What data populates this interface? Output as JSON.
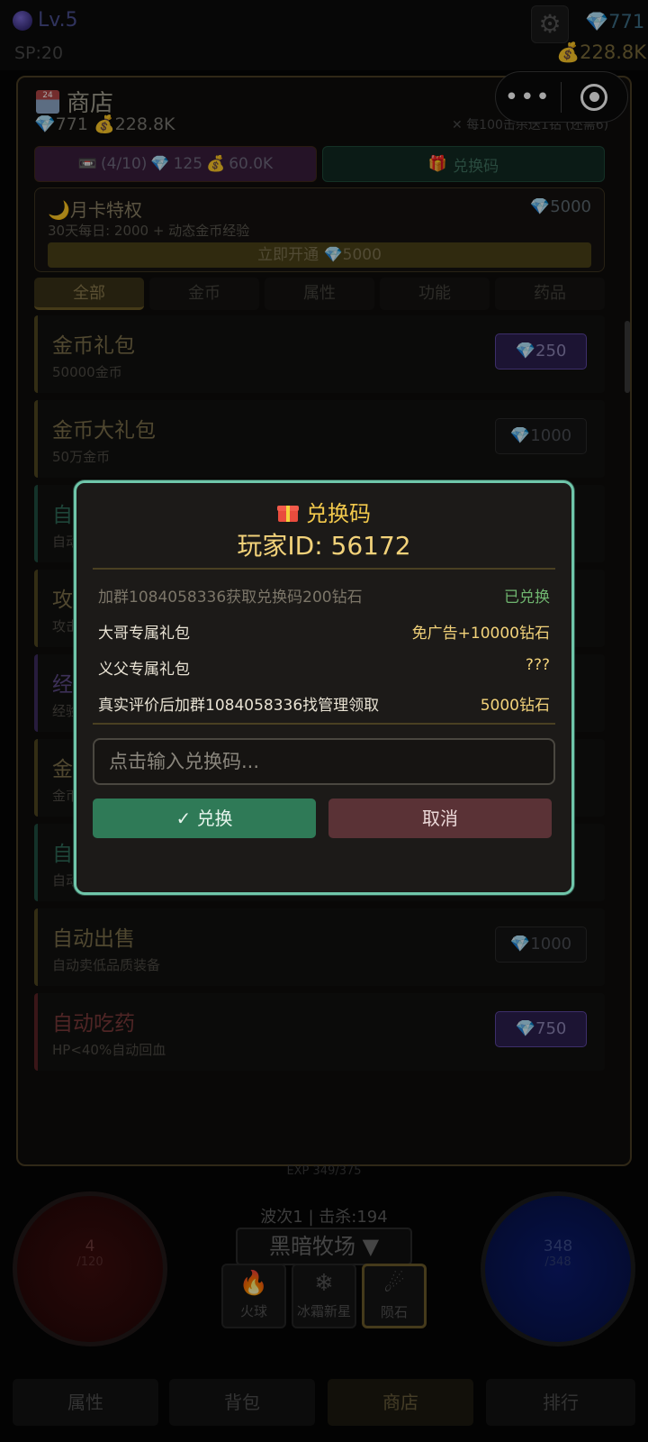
{
  "topbar": {
    "level": "Lv.5",
    "sp": "SP:20",
    "gems": "771",
    "gold": "228.8K"
  },
  "shop": {
    "title": "商店",
    "gems": "771",
    "gold": "228.8K",
    "kill_note": "每100击杀送1钻 (还需6)",
    "ad_button": "(4/10)",
    "ad_gems": "125",
    "ad_gold": "60.0K",
    "code_button": "兑换码",
    "month_card": {
      "title": "月卡特权",
      "price": "5000",
      "desc": "30天每日: 2000 + 动态金币经验",
      "button": "立即开通",
      "button_price": "5000"
    },
    "tabs": [
      "全部",
      "金币",
      "属性",
      "功能",
      "药品"
    ],
    "items": [
      {
        "name": "金币礼包",
        "desc": "50000金币",
        "price": "250"
      },
      {
        "name": "金币大礼包",
        "desc": "50万金币",
        "price": "1000"
      },
      {
        "name": "自",
        "desc": "自动",
        "price": ""
      },
      {
        "name": "攻",
        "desc": "攻击",
        "price": ""
      },
      {
        "name": "经",
        "desc": "经验",
        "price": ""
      },
      {
        "name": "金",
        "desc": "金币",
        "price": ""
      },
      {
        "name": "自",
        "desc": "自动穿戴更强装备",
        "price": ""
      },
      {
        "name": "自动出售",
        "desc": "自动卖低品质装备",
        "price": "1000"
      },
      {
        "name": "自动吃药",
        "desc": "HP<40%自动回血",
        "price": "750"
      }
    ]
  },
  "hud": {
    "exp": "EXP 349/375",
    "hp": "4",
    "hp_max": "/120",
    "mp": "348",
    "mp_max": "/348",
    "wave": "波次1 | 击杀:194",
    "scene": "黑暗牧场 ▼",
    "skills": [
      "火球",
      "冰霜新星",
      "陨石"
    ]
  },
  "nav": [
    "属性",
    "背包",
    "商店",
    "排行"
  ],
  "modal": {
    "title": "兑换码",
    "player_id": "玩家ID: 56172",
    "rows": [
      {
        "label": "加群1084058336获取兑换码200钻石",
        "value": "已兑换"
      },
      {
        "label": "大哥专属礼包",
        "value": "免广告+10000钻石"
      },
      {
        "label": "义父专属礼包",
        "value": "???"
      },
      {
        "label": "真实评价后加群1084058336找管理领取",
        "value": "5000钻石"
      }
    ],
    "input_placeholder": "点击输入兑换码...",
    "confirm": "兑换",
    "cancel": "取消"
  }
}
